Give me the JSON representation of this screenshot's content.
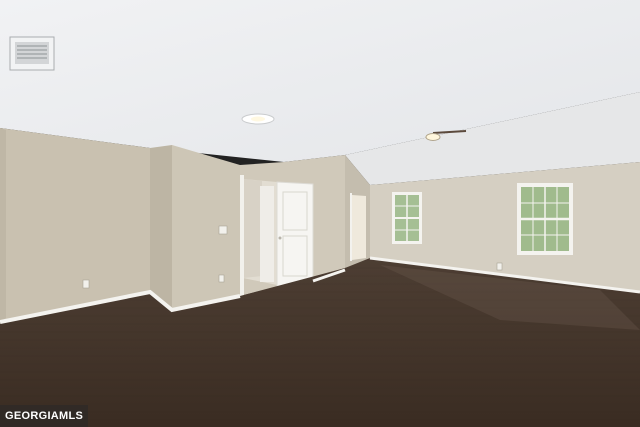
{
  "watermark": {
    "text": "GEORGIAMLS"
  },
  "colors": {
    "ceiling": "#eceef0",
    "wall_left": "#cdc5b4",
    "wall_back": "#d3cdbf",
    "wall_right": "#d6d0c3",
    "floor": "#4a3a2e",
    "trim": "#f3f2ee",
    "window_glass": "#9fb98e"
  },
  "scene": {
    "description_items": [
      "hvac-vent",
      "ceiling-light",
      "ceiling-fan",
      "interior-door",
      "window-left",
      "window-right",
      "outlet",
      "light-switch",
      "hardwood-floor"
    ]
  }
}
